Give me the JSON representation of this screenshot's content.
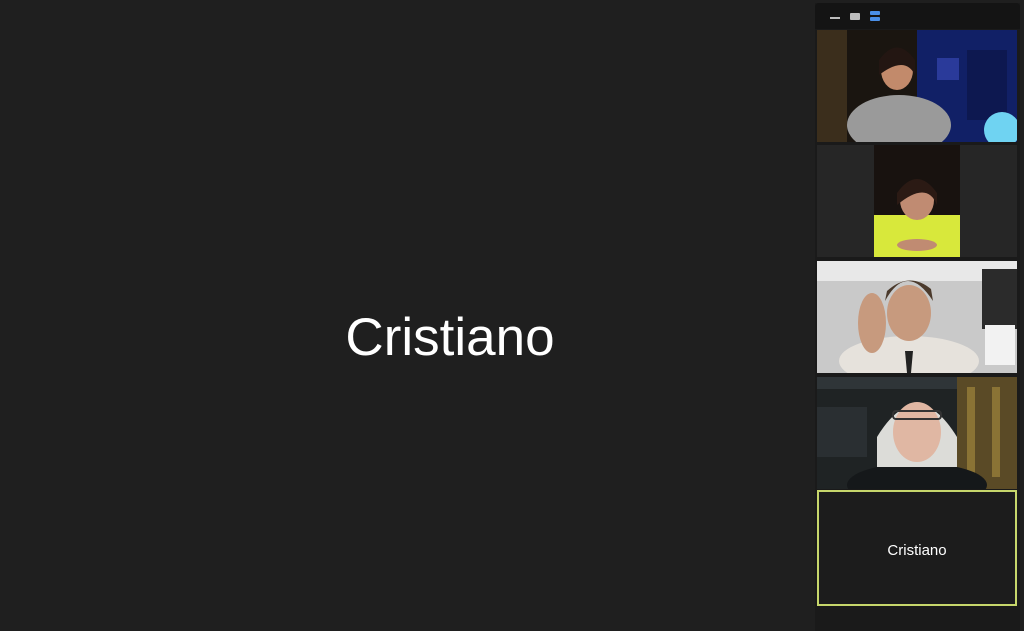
{
  "meeting": {
    "active_speaker_name": "Cristiano"
  },
  "view_controls": {
    "items": [
      "minimize-icon",
      "filmstrip-icon",
      "stacked-view-icon"
    ],
    "accent": "#4a8fe7"
  },
  "participants": [
    {
      "type": "video",
      "description_icon": "camera-feed"
    },
    {
      "type": "video",
      "description_icon": "camera-feed"
    },
    {
      "type": "video",
      "description_icon": "camera-feed"
    },
    {
      "type": "video",
      "description_icon": "camera-feed"
    },
    {
      "type": "name",
      "name": "Cristiano",
      "active": true,
      "border_color": "#c6d66b"
    }
  ]
}
